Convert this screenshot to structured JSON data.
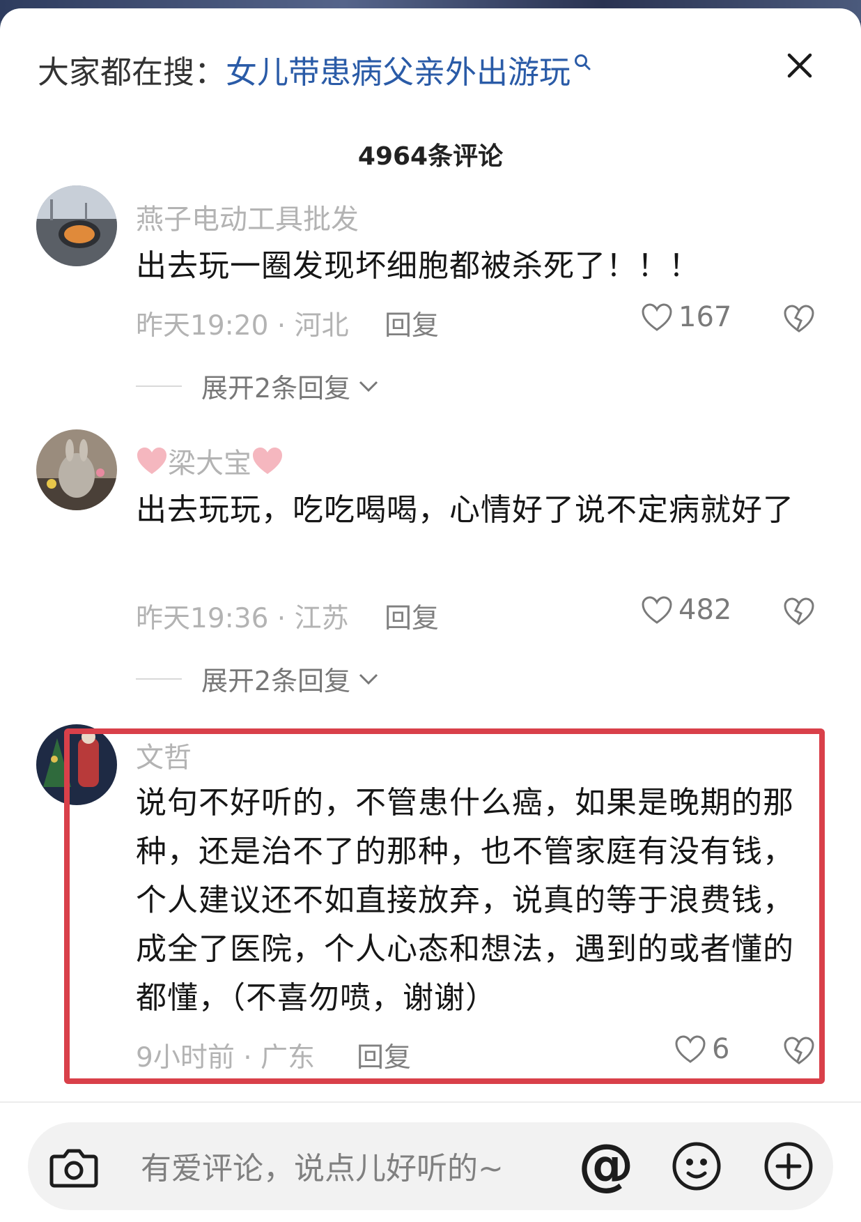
{
  "search_hint": {
    "prefix": "大家都在搜：",
    "term": "女儿带患病父亲外出游玩"
  },
  "comment_count": "4964条评论",
  "comments": [
    {
      "username": "燕子电动工具批发",
      "text": "出去玩一圈发现坏细胞都被杀死了！！！",
      "meta": "昨天19:20 · 河北",
      "reply_label": "回复",
      "likes": "167",
      "expand_label": "展开2条回复"
    },
    {
      "username": "梁大宝",
      "text": "出去玩玩，吃吃喝喝，心情好了说不定病就好了",
      "meta": "昨天19:36 · 江苏",
      "reply_label": "回复",
      "likes": "482",
      "expand_label": "展开2条回复"
    },
    {
      "username": "文哲",
      "text": "说句不好听的，不管患什么癌，如果是晚期的那种，还是治不了的那种，也不管家庭有没有钱，个人建议还不如直接放弃，说真的等于浪费钱，成全了医院，个人心态和想法，遇到的或者懂的都懂，（不喜勿喷，谢谢）",
      "meta": "9小时前 · 广东",
      "reply_label": "回复",
      "likes": "6"
    }
  ],
  "input": {
    "placeholder": "有爱评论，说点儿好听的~",
    "at_symbol": "@"
  },
  "colors": {
    "search_term": "#2a5ba7",
    "highlight_border": "#d9404a",
    "meta_gray": "#b3b3b3"
  },
  "icons": [
    "search-icon",
    "close-icon",
    "heart-icon",
    "broken-heart-icon",
    "chevron-down-icon",
    "camera-icon",
    "at-icon",
    "emoji-icon",
    "plus-icon"
  ]
}
